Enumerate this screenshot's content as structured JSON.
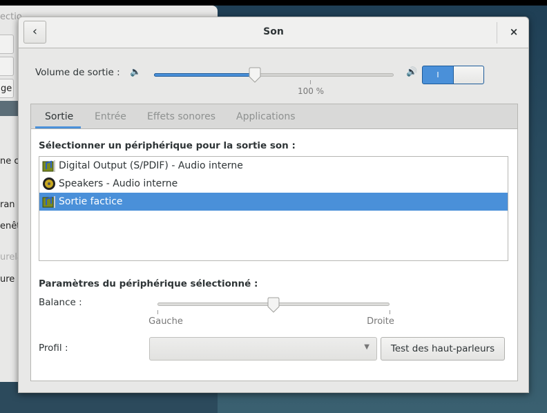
{
  "background_window": {
    "fragments": [
      "ectio",
      "ne co",
      "ran",
      "enêtr",
      "urela",
      "ure l",
      "ge"
    ]
  },
  "dialog": {
    "title": "Son",
    "back_icon": "chevron-left-icon",
    "close_label": "×",
    "volume": {
      "label": "Volume de sortie :",
      "value_label": "100 %",
      "knob_fraction": 0.42,
      "mute_enabled": true,
      "switch_on_label": "I"
    },
    "tabs": [
      {
        "label": "Sortie",
        "active": true
      },
      {
        "label": "Entrée"
      },
      {
        "label": "Effets sonores"
      },
      {
        "label": "Applications"
      }
    ],
    "output": {
      "select_label": "Sélectionner un périphérique pour la sortie son :",
      "devices": [
        {
          "label": "Digital Output (S/PDIF) - Audio interne",
          "icon": "sound-card-icon"
        },
        {
          "label": "Speakers - Audio interne",
          "icon": "speaker-icon"
        },
        {
          "label": "Sortie factice",
          "icon": "sound-card-icon",
          "selected": true
        }
      ],
      "params_label": "Paramètres du périphérique sélectionné :",
      "balance_label": "Balance :",
      "balance_left": "Gauche",
      "balance_right": "Droite",
      "balance_value": 0.5,
      "profile_label": "Profil :",
      "profile_value": "",
      "test_button": "Test des haut-parleurs"
    },
    "colors": {
      "accent": "#4a90d9"
    }
  }
}
